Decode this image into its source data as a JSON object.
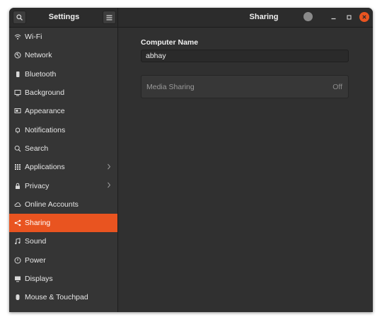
{
  "header": {
    "sidebar_title": "Settings",
    "panel_title": "Sharing"
  },
  "sidebar": {
    "items": [
      {
        "label": "Wi-Fi",
        "icon": "wifi-icon"
      },
      {
        "label": "Network",
        "icon": "network-icon"
      },
      {
        "label": "Bluetooth",
        "icon": "bluetooth-icon"
      },
      {
        "label": "Background",
        "icon": "background-icon"
      },
      {
        "label": "Appearance",
        "icon": "appearance-icon"
      },
      {
        "label": "Notifications",
        "icon": "bell-icon"
      },
      {
        "label": "Search",
        "icon": "search-icon"
      },
      {
        "label": "Applications",
        "icon": "grid-icon"
      },
      {
        "label": "Privacy",
        "icon": "lock-icon"
      },
      {
        "label": "Online Accounts",
        "icon": "cloud-icon"
      },
      {
        "label": "Sharing",
        "icon": "share-icon"
      },
      {
        "label": "Sound",
        "icon": "music-note-icon"
      },
      {
        "label": "Power",
        "icon": "power-icon"
      },
      {
        "label": "Displays",
        "icon": "display-icon"
      },
      {
        "label": "Mouse & Touchpad",
        "icon": "mouse-icon"
      }
    ],
    "active": "Sharing"
  },
  "content": {
    "computer_name_label": "Computer Name",
    "computer_name_value": "abhay",
    "media_sharing_label": "Media Sharing",
    "media_sharing_status": "Off"
  },
  "colors": {
    "accent": "#e95420",
    "window_bg": "#303030",
    "sidebar_bg": "#353535"
  }
}
